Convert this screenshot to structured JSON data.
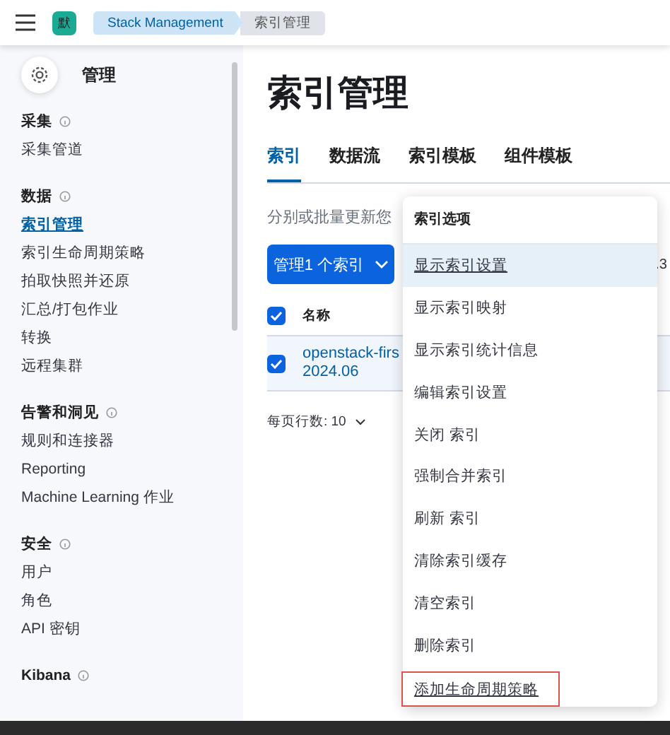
{
  "header": {
    "avatar": "默",
    "breadcrumbs": [
      {
        "label": "Stack Management",
        "selected": false
      },
      {
        "label": "索引管理",
        "selected": true
      }
    ]
  },
  "sidebar": {
    "title": "管理",
    "sections": [
      {
        "heading": "采集",
        "items": [
          {
            "label": "采集管道",
            "selected": false
          }
        ]
      },
      {
        "heading": "数据",
        "items": [
          {
            "label": "索引管理",
            "selected": true
          },
          {
            "label": "索引生命周期策略",
            "selected": false
          },
          {
            "label": "拍取快照并还原",
            "selected": false
          },
          {
            "label": "汇总/打包作业",
            "selected": false
          },
          {
            "label": "转换",
            "selected": false
          },
          {
            "label": "远程集群",
            "selected": false
          }
        ]
      },
      {
        "heading": "告警和洞见",
        "items": [
          {
            "label": "规则和连接器",
            "selected": false
          },
          {
            "label": "Reporting",
            "selected": false
          },
          {
            "label": "Machine Learning 作业",
            "selected": false
          }
        ]
      },
      {
        "heading": "安全",
        "items": [
          {
            "label": "用户",
            "selected": false
          },
          {
            "label": "角色",
            "selected": false
          },
          {
            "label": "API 密钥",
            "selected": false
          }
        ]
      },
      {
        "heading": "Kibana"
      }
    ]
  },
  "main": {
    "title": "索引管理",
    "tabs": [
      {
        "label": "索引",
        "selected": true
      },
      {
        "label": "数据流",
        "selected": false
      },
      {
        "label": "索引模板",
        "selected": false
      },
      {
        "label": "组件模板",
        "selected": false
      }
    ],
    "description": "分别或批量更新您",
    "manage_button": "管理1 个索引",
    "side_value": ".3",
    "table": {
      "column": "名称",
      "all_checked": true,
      "rows": [
        {
          "name_lines": [
            "openstack-firs",
            "2024.06"
          ],
          "checked": true
        }
      ]
    },
    "pagination": "每页行数: 10"
  },
  "menu": {
    "title": "索引选项",
    "items": [
      {
        "label": "显示索引设置",
        "selected": true,
        "highlighted": false
      },
      {
        "label": "显示索引映射",
        "selected": false,
        "highlighted": false
      },
      {
        "label": "显示索引统计信息",
        "selected": false,
        "highlighted": false
      },
      {
        "label": "编辑索引设置",
        "selected": false,
        "highlighted": false
      },
      {
        "label": "关闭 索引",
        "selected": false,
        "highlighted": false
      },
      {
        "label": "强制合并索引",
        "selected": false,
        "highlighted": false
      },
      {
        "label": "刷新 索引",
        "selected": false,
        "highlighted": false
      },
      {
        "label": "清除索引缓存",
        "selected": false,
        "highlighted": false
      },
      {
        "label": "清空索引",
        "selected": false,
        "highlighted": false
      },
      {
        "label": "删除索引",
        "selected": false,
        "highlighted": false
      },
      {
        "label": "添加生命周期策略",
        "selected": false,
        "highlighted": true
      }
    ]
  }
}
